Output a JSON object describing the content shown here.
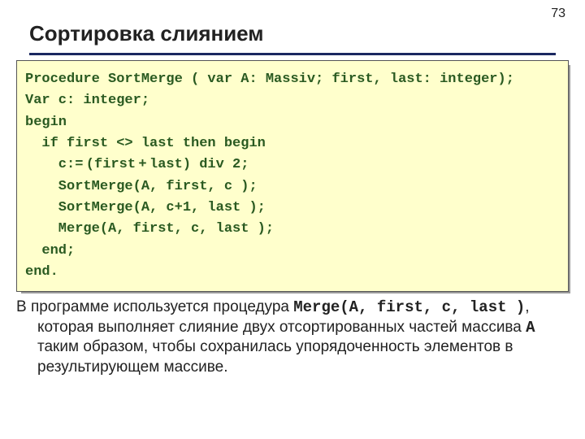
{
  "page_number": "73",
  "title": "Сортировка слиянием",
  "code": {
    "l0": "Procedure SortMerge ( var A: Massiv; first, last: integer);",
    "l1": "Var c: integer;",
    "l2": "begin",
    "l3": "  if first <> last then begin",
    "l4": "    c:= (first + last) div 2;",
    "l5": "    SortMerge(A, first, c );",
    "l6": "    SortMerge(A, c+1, last );",
    "l7": "    Merge(A, first, c, last );",
    "l8": "  end;",
    "l9": "end."
  },
  "paragraph": {
    "pre": "В программе используется процедура ",
    "mono1": "Merge(A, first, c, last )",
    "mid1": ", которая выполняет слияние двух отсортированных частей массива ",
    "mono2": "A",
    "mid2": " таким образом, чтобы сохранилась упорядоченность элементов в результирующем массиве."
  }
}
